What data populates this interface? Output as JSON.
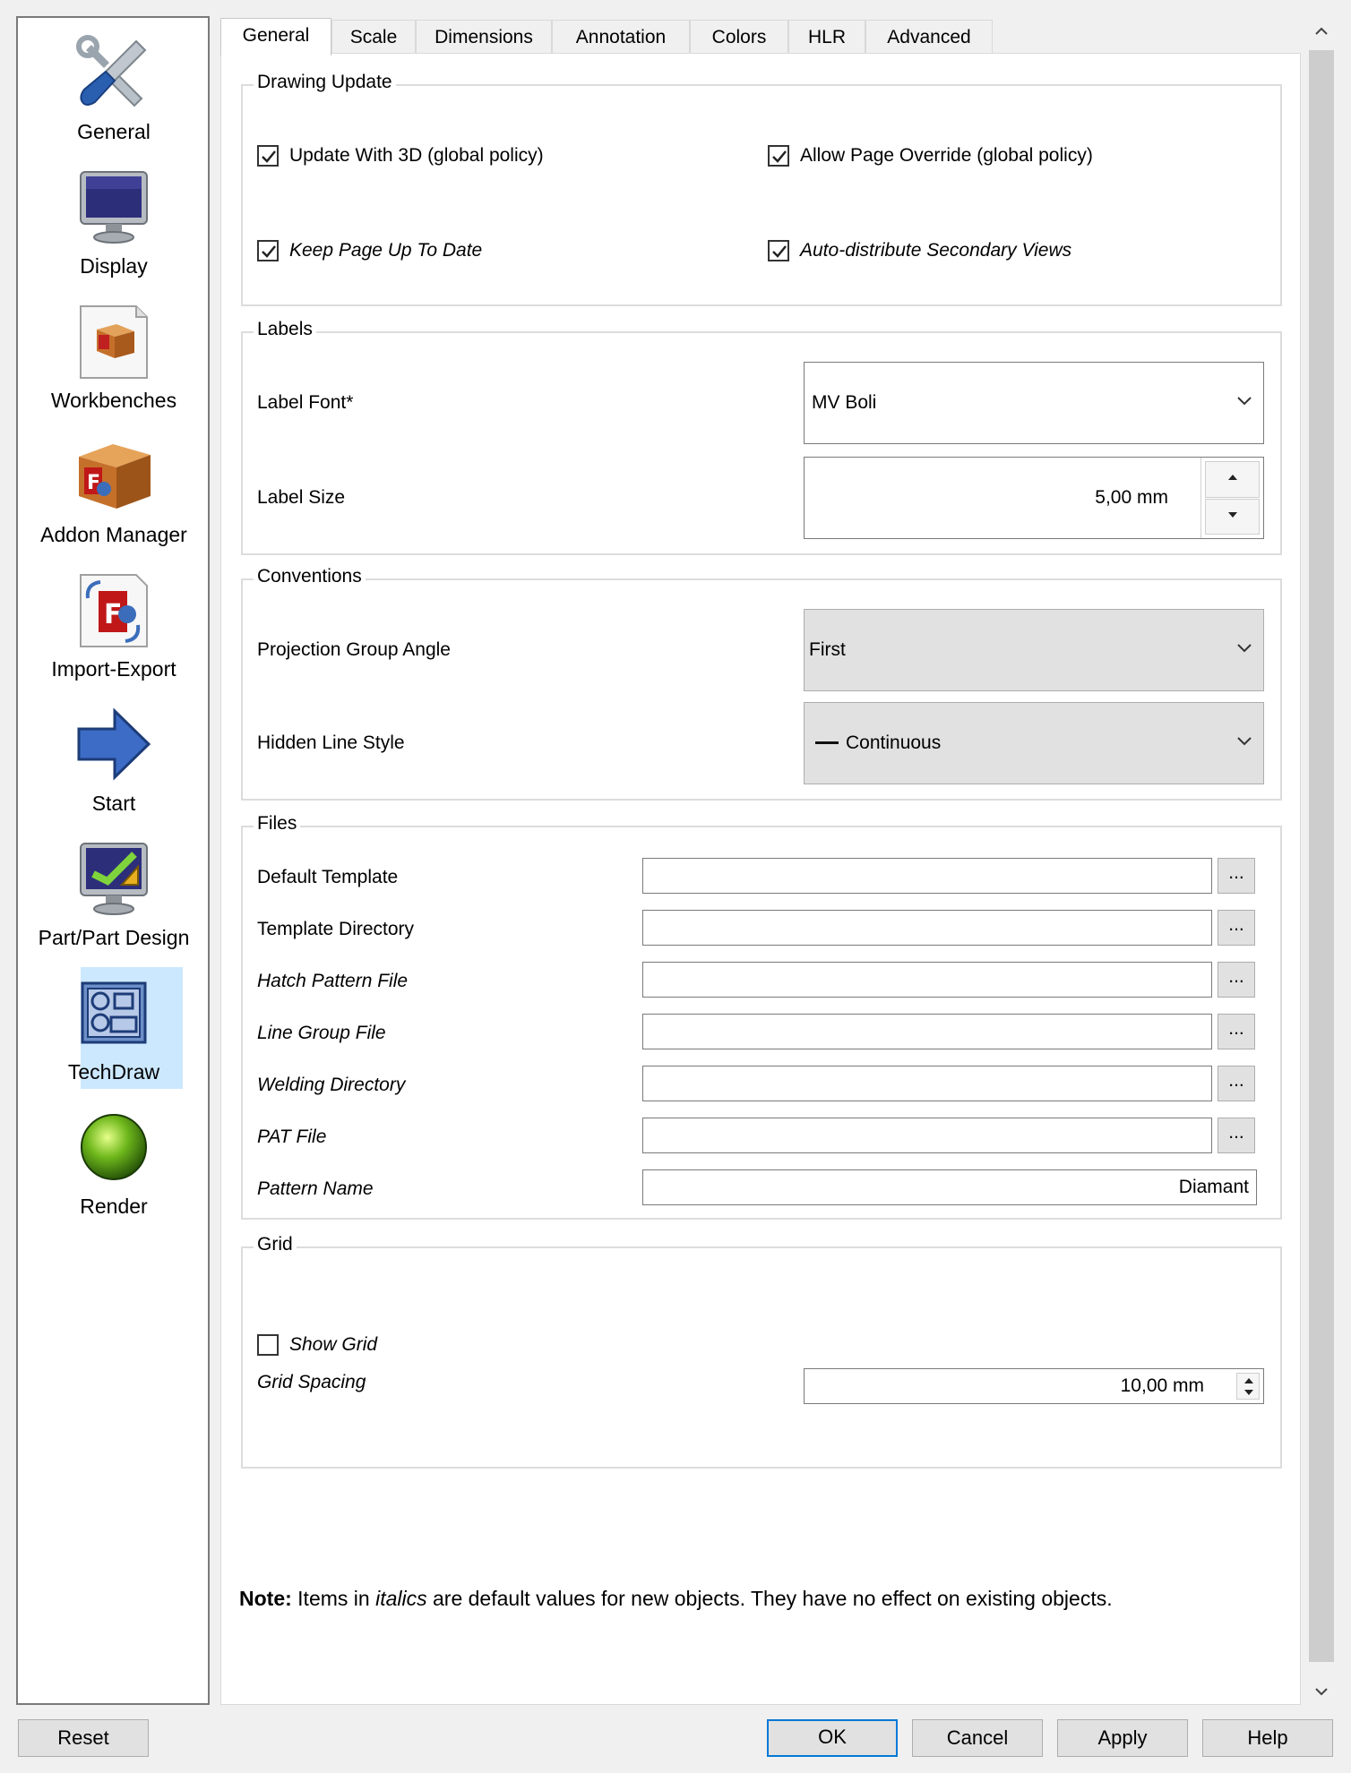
{
  "sidebar": {
    "items": [
      {
        "label": "General",
        "icon": "tools-icon"
      },
      {
        "label": "Display",
        "icon": "monitor-icon"
      },
      {
        "label": "Workbenches",
        "icon": "workbench-box-icon"
      },
      {
        "label": "Addon Manager",
        "icon": "addon-box-icon"
      },
      {
        "label": "Import-Export",
        "icon": "import-export-icon"
      },
      {
        "label": "Start",
        "icon": "arrow-right-icon"
      },
      {
        "label": "Part/Part Design",
        "icon": "part-design-icon"
      },
      {
        "label": "TechDraw",
        "icon": "techdraw-icon"
      },
      {
        "label": "Render",
        "icon": "sphere-icon"
      }
    ],
    "selected": "TechDraw"
  },
  "tabs": [
    "General",
    "Scale",
    "Dimensions",
    "Annotation",
    "Colors",
    "HLR",
    "Advanced"
  ],
  "active_tab": "General",
  "drawing_update": {
    "title": "Drawing Update",
    "update_with_3d": {
      "label": "Update With 3D (global policy)",
      "checked": true
    },
    "allow_page_override": {
      "label": "Allow Page Override (global policy)",
      "checked": true
    },
    "keep_page_up_to_date": {
      "label": "Keep Page Up To Date",
      "checked": true
    },
    "auto_distribute": {
      "label": "Auto-distribute Secondary Views",
      "checked": true
    }
  },
  "labels": {
    "title": "Labels",
    "font_label": "Label Font*",
    "font_value": "MV Boli",
    "size_label": "Label Size",
    "size_value": "5,00 mm"
  },
  "conventions": {
    "title": "Conventions",
    "projection_label": "Projection Group Angle",
    "projection_value": "First",
    "hidden_line_label": "Hidden Line Style",
    "hidden_line_value": "Continuous"
  },
  "files": {
    "title": "Files",
    "browse_label": "...",
    "default_template": {
      "label": "Default Template",
      "value": ""
    },
    "template_directory": {
      "label": "Template Directory",
      "value": ""
    },
    "hatch_pattern_file": {
      "label": "Hatch Pattern File",
      "value": ""
    },
    "line_group_file": {
      "label": "Line Group File",
      "value": ""
    },
    "welding_directory": {
      "label": "Welding Directory",
      "value": ""
    },
    "pat_file": {
      "label": "PAT File",
      "value": ""
    },
    "pattern_name": {
      "label": "Pattern Name",
      "value": "Diamant"
    }
  },
  "grid": {
    "title": "Grid",
    "show_grid": {
      "label": "Show Grid",
      "checked": false
    },
    "spacing_label": "Grid Spacing",
    "spacing_value": "10,00 mm"
  },
  "note": {
    "bold": "Note:",
    "pre": " Items in ",
    "italic": "italics",
    "post": " are default values for new objects. They have no effect on existing objects."
  },
  "buttons": {
    "reset": "Reset",
    "ok": "OK",
    "cancel": "Cancel",
    "apply": "Apply",
    "help": "Help"
  },
  "colors": {
    "selection": "#cce8ff",
    "default_button_border": "#0078d7"
  }
}
